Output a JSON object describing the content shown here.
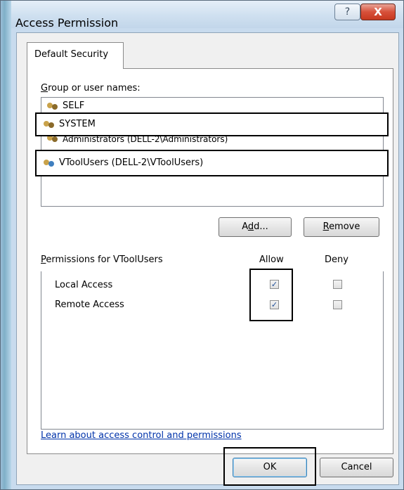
{
  "window": {
    "title": "Access Permission",
    "help_icon": "?",
    "close_icon": "X"
  },
  "tab": {
    "label": "Default Security"
  },
  "groups": {
    "label_prefix": "G",
    "label_rest": "roup or user names:",
    "items": [
      {
        "name": "SELF"
      },
      {
        "name": "SYSTEM"
      },
      {
        "name": "Administrators (DELL-2\\Administrators)"
      },
      {
        "name": "VToolUsers (DELL-2\\VToolUsers)"
      }
    ]
  },
  "buttons": {
    "add_pre": "A",
    "add_ul": "d",
    "add_post": "d...",
    "remove_ul": "R",
    "remove_post": "emove",
    "ok": "OK",
    "cancel": "Cancel"
  },
  "permissions": {
    "header_ul": "P",
    "header_rest": "ermissions for VToolUsers",
    "allow_label": "Allow",
    "deny_label": "Deny",
    "rows": [
      {
        "name": "Local Access",
        "allow": true,
        "deny": false
      },
      {
        "name": "Remote Access",
        "allow": true,
        "deny": false
      }
    ]
  },
  "link": {
    "text": "Learn about access control and permissions"
  },
  "colors": {
    "title_bar": "#cfe0f0",
    "close_button": "#d7503a",
    "link": "#0033aa",
    "accent_check": "#1f4f9a"
  }
}
